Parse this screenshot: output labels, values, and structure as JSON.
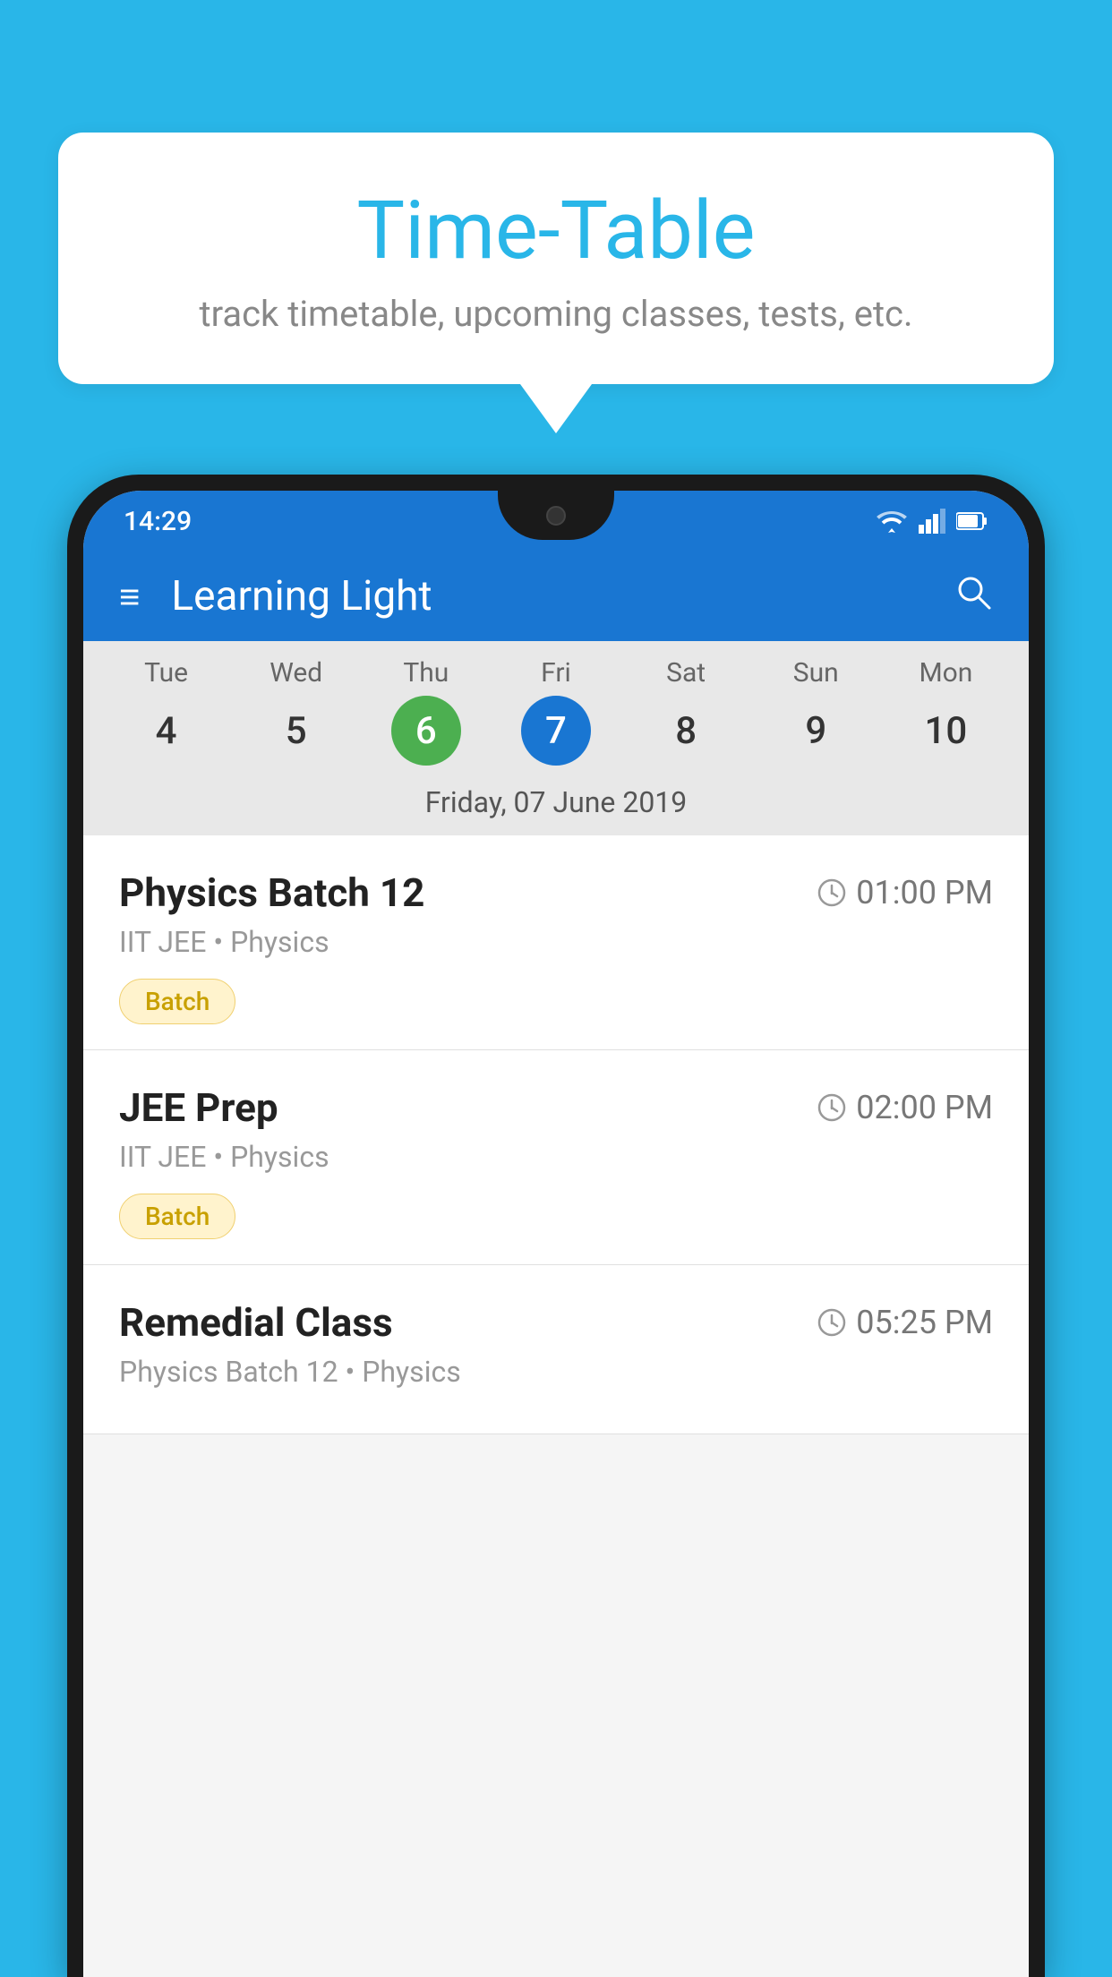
{
  "background_color": "#29b6e8",
  "speech_bubble": {
    "title": "Time-Table",
    "subtitle": "track timetable, upcoming classes, tests, etc."
  },
  "phone": {
    "status_bar": {
      "time": "14:29",
      "icons": [
        "wifi",
        "signal",
        "battery"
      ]
    },
    "app_bar": {
      "title": "Learning Light",
      "menu_icon": "≡",
      "search_icon": "🔍"
    },
    "calendar": {
      "days": [
        {
          "name": "Tue",
          "num": "4",
          "state": "normal"
        },
        {
          "name": "Wed",
          "num": "5",
          "state": "normal"
        },
        {
          "name": "Thu",
          "num": "6",
          "state": "today"
        },
        {
          "name": "Fri",
          "num": "7",
          "state": "selected"
        },
        {
          "name": "Sat",
          "num": "8",
          "state": "normal"
        },
        {
          "name": "Sun",
          "num": "9",
          "state": "normal"
        },
        {
          "name": "Mon",
          "num": "10",
          "state": "normal"
        }
      ],
      "selected_date_label": "Friday, 07 June 2019"
    },
    "events": [
      {
        "name": "Physics Batch 12",
        "time": "01:00 PM",
        "subtitle": "IIT JEE • Physics",
        "tag": "Batch"
      },
      {
        "name": "JEE Prep",
        "time": "02:00 PM",
        "subtitle": "IIT JEE • Physics",
        "tag": "Batch"
      },
      {
        "name": "Remedial Class",
        "time": "05:25 PM",
        "subtitle": "Physics Batch 12 • Physics",
        "tag": ""
      }
    ]
  }
}
